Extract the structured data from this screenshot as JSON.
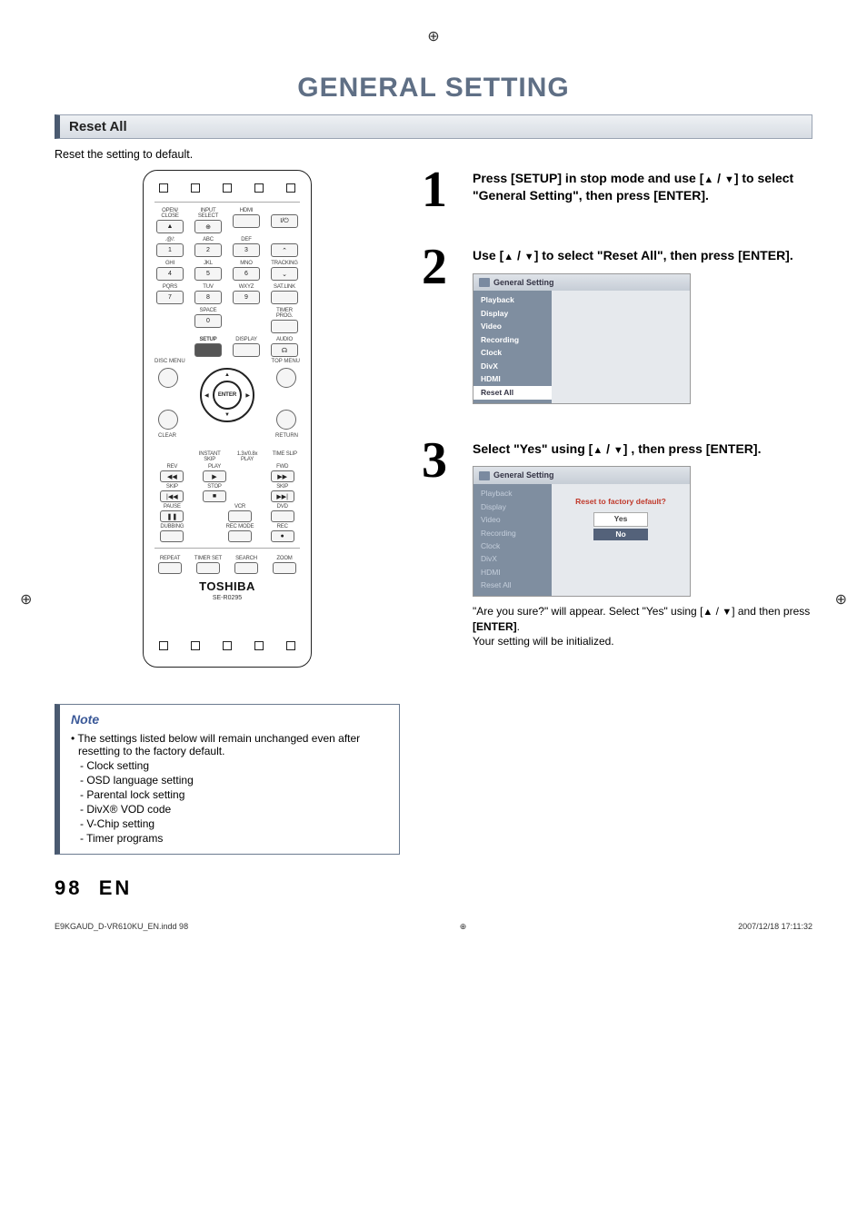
{
  "page": {
    "title": "GENERAL SETTING",
    "section_bar": "Reset All",
    "intro": "Reset the setting to default.",
    "page_num": "98",
    "lang": "EN"
  },
  "remote": {
    "brand": "TOSHIBA",
    "model": "SE-R0295",
    "labels": {
      "open_close": "OPEN/\nCLOSE",
      "input_select": "INPUT\nSELECT",
      "hdmi": "HDMI",
      "power": "I/⏻",
      "row2": [
        ".@/:",
        "ABC",
        "DEF",
        ""
      ],
      "row3": [
        "GHI",
        "JKL",
        "MNO",
        "TRACKING"
      ],
      "row4": [
        "PQRS",
        "TUV",
        "WXYZ",
        "SAT.LINK"
      ],
      "space": "SPACE",
      "timer_prog": "TIMER\nPROG.",
      "setup": "SETUP",
      "display": "DISPLAY",
      "audio": "AUDIO",
      "disc_menu": "DISC MENU",
      "top_menu": "TOP MENU",
      "enter": "ENTER",
      "clear": "CLEAR",
      "return": "RETURN",
      "instant_skip": "INSTANT\nSKIP",
      "play_speed": "1.3x/0.8x\nPLAY",
      "time_slip": "TIME SLIP",
      "rev": "REV",
      "play": "PLAY",
      "fwd": "FWD",
      "skip_l": "SKIP",
      "stop": "STOP",
      "skip_r": "SKIP",
      "pause": "PAUSE",
      "vcr": "VCR",
      "dvd": "DVD",
      "dubbing": "DUBBING",
      "rec_mode": "REC MODE",
      "rec": "REC",
      "repeat": "REPEAT",
      "timer_set": "TIMER SET",
      "search": "SEARCH",
      "zoom": "ZOOM"
    },
    "keys": {
      "1": "1",
      "2": "2",
      "3": "3",
      "4": "4",
      "5": "5",
      "6": "6",
      "7": "7",
      "8": "8",
      "9": "9",
      "0": "0"
    }
  },
  "steps": {
    "s1": {
      "num": "1",
      "text_a": "Press [SETUP] in stop mode and use [",
      "tri_up": "▲",
      "sep": " / ",
      "tri_dn": "▼",
      "text_b": "] to select \"General Setting\", then press [ENTER]."
    },
    "s2": {
      "num": "2",
      "text_a": "Use [",
      "text_b": "] to select \"Reset All\", then press [ENTER].",
      "menu": {
        "title": "General Setting",
        "items": [
          "Playback",
          "Display",
          "Video",
          "Recording",
          "Clock",
          "DivX",
          "HDMI",
          "Reset All"
        ],
        "selected": "Reset All"
      }
    },
    "s3": {
      "num": "3",
      "text_a": "Select \"Yes\" using [",
      "text_b": "] , then press [ENTER].",
      "menu": {
        "title": "General Setting",
        "items": [
          "Playback",
          "Display",
          "Video",
          "Recording",
          "Clock",
          "DivX",
          "HDMI",
          "Reset All"
        ],
        "dialog_q": "Reset to factory default?",
        "yes": "Yes",
        "no": "No",
        "selected_opt": "No"
      },
      "after_a": "\"Are you sure?\" will appear.  Select \"Yes\" using [",
      "after_b": "] and then press ",
      "after_enter": "[ENTER]",
      "after_c": ".",
      "after_d": "Your setting will be initialized."
    }
  },
  "note": {
    "title": "Note",
    "main": "The settings listed below will remain unchanged even after resetting to the factory default.",
    "subs": [
      "- Clock setting",
      "- OSD language setting",
      "- Parental lock setting",
      "- DivX® VOD code",
      "- V-Chip setting",
      "- Timer programs"
    ]
  },
  "footer": {
    "left": "E9KGAUD_D-VR610KU_EN.indd   98",
    "right": "2007/12/18   17:11:32"
  }
}
